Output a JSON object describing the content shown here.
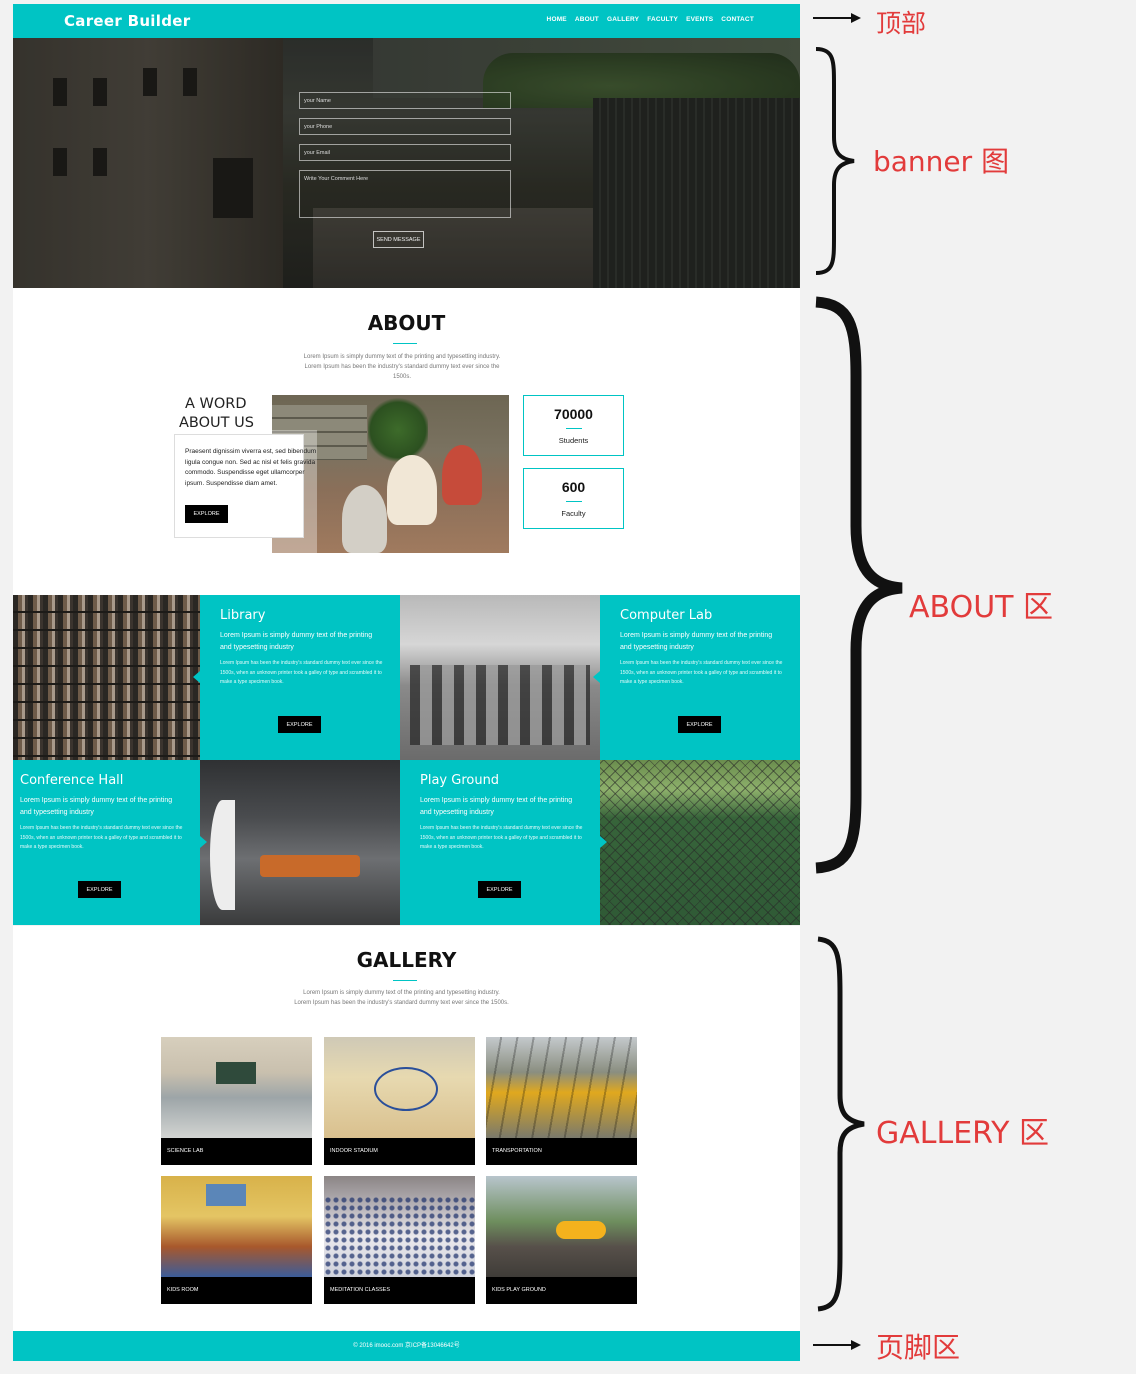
{
  "header": {
    "logo": "Career Builder",
    "nav": [
      "HOME",
      "ABOUT",
      "GALLERY",
      "FACULTY",
      "EVENTS",
      "CONTACT"
    ]
  },
  "banner": {
    "form": {
      "name_placeholder": "your Name",
      "phone_placeholder": "your Phone",
      "email_placeholder": "your Email",
      "comment_placeholder": "Write Your Comment Here",
      "send_label": "SEND MESSAGE"
    }
  },
  "about": {
    "title": "ABOUT",
    "description": "Lorem Ipsum is simply dummy text of the printing and typesetting industry. Lorem Ipsum has been the industry's standard dummy text ever since the 1500s.",
    "word_title_1": "A WORD",
    "word_title_2": "ABOUT US",
    "word_text": "Praesent dignissim viverra est, sed bibendum ligula congue non. Sed ac nisl et felis gravida commodo. Suspendisse eget ullamcorper ipsum. Suspendisse diam amet.",
    "explore_label": "EXPLORE",
    "stats": [
      {
        "number": "70000",
        "label": "Students"
      },
      {
        "number": "600",
        "label": "Faculty"
      }
    ]
  },
  "facilities": [
    {
      "title": "Library",
      "subtitle": "Lorem Ipsum is simply dummy text of the printing and typesetting industry",
      "body": "Lorem Ipsum has been the industry's standard dummy text ever since the 1500s, when an unknown printer took a galley of type and scrambled it to make a type specimen book.",
      "button": "EXPLORE"
    },
    {
      "title": "Computer Lab",
      "subtitle": "Lorem Ipsum is simply dummy text of the printing and typesetting industry",
      "body": "Lorem Ipsum has been the industry's standard dummy text ever since the 1500s, when an unknown printer took a galley of type and scrambled it to make a type specimen book.",
      "button": "EXPLORE"
    },
    {
      "title": "Conference Hall",
      "subtitle": "Lorem Ipsum is simply dummy text of the printing and typesetting industry",
      "body": "Lorem Ipsum has been the industry's standard dummy text ever since the 1500s, when an unknown printer took a galley of type and scrambled it to make a type specimen book.",
      "button": "EXPLORE"
    },
    {
      "title": "Play Ground",
      "subtitle": "Lorem Ipsum is simply dummy text of the printing and typesetting industry",
      "body": "Lorem Ipsum has been the industry's standard dummy text ever since the 1500s, when an unknown printer took a galley of type and scrambled it to make a type specimen book.",
      "button": "EXPLORE"
    }
  ],
  "gallery": {
    "title": "GALLERY",
    "description": "Lorem Ipsum is simply dummy text of the printing and typesetting industry. Lorem Ipsum has been the industry's standard dummy text ever since the 1500s.",
    "items": [
      "SCIENCE LAB",
      "INDOOR STADIUM",
      "TRANSPORTATION",
      "KIDS ROOM",
      "MEDITATION CLASSES",
      "KIDS PLAY GROUND"
    ]
  },
  "footer": {
    "copyright": "© 2016 imooc.com 京ICP备13046642号"
  },
  "annotations": {
    "top": "顶部",
    "banner": "banner 图",
    "about": "ABOUT 区",
    "gallery": "GALLERY 区",
    "footer": "页脚区"
  },
  "colors": {
    "accent": "#00c4c4",
    "annotation": "#e23b3b"
  }
}
